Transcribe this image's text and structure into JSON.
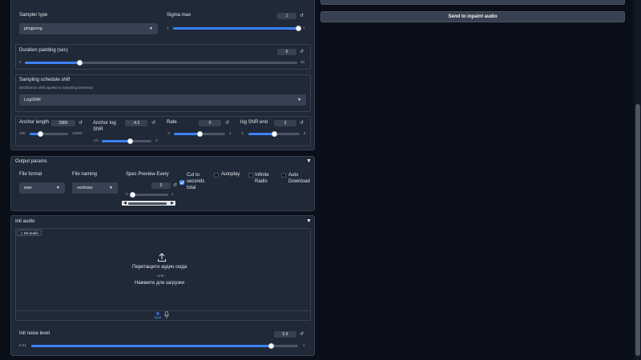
{
  "sampler": {
    "type_label": "Sampler type",
    "type_value": "pingpong",
    "sigma_max_label": "Sigma max",
    "sigma_max_value": "1",
    "sigma_max_min": "1",
    "sigma_max_max": "1",
    "sigma_max_fraction": 1.0
  },
  "duration": {
    "label": "Duration padding (sec)",
    "value": "6",
    "min": "0",
    "max": "30",
    "fraction": 0.2
  },
  "schedule": {
    "label": "Sampling schedule shift",
    "description": "Distribution shift applied to sampling timesteps",
    "value": "LogSNR"
  },
  "shift_params": [
    {
      "label": "Anchor length",
      "value": "2880",
      "min": "100",
      "max": "10000",
      "fraction": 0.28
    },
    {
      "label": "Anchor log SNR",
      "value": "-4.2",
      "min": "-10",
      "max": "0",
      "fraction": 0.58
    },
    {
      "label": "Rate",
      "value": "0",
      "min": "-2",
      "max": "2",
      "fraction": 0.5
    },
    {
      "label": "log SNR end",
      "value": "2",
      "min": "-2",
      "max": "6",
      "fraction": 0.5
    }
  ],
  "output_params": {
    "title": "Output params",
    "file_format_label": "File format",
    "file_format_value": "wav",
    "file_naming_label": "File naming",
    "file_naming_value": "verbose",
    "spec_preview_label": "Spec Preview Every",
    "spec_preview_value": "0",
    "spec_preview_min": "0",
    "spec_preview_max": "1",
    "spec_preview_fraction": 0.0,
    "cut_label": "Cut to seconds total",
    "autoplay_label": "Autoplay",
    "infinite_label": "Infinite Radio",
    "auto_download_label": "Auto Download"
  },
  "init_audio": {
    "title": "Init audio",
    "badge": "Init audio",
    "drop_text": "Перетащите аудио сюда",
    "or_text": "- или -",
    "click_text": "Нажмите для загрузки",
    "noise_label": "Init noise level",
    "noise_value": "0.9",
    "noise_min": "0.01",
    "noise_max": "1",
    "noise_fraction": 0.9
  },
  "right": {
    "inpaint_button": "Send to inpaint audio"
  },
  "icons": {
    "reset": "reset-icon",
    "upload": "upload-icon",
    "mic": "microphone-icon",
    "music": "music-note-icon"
  }
}
